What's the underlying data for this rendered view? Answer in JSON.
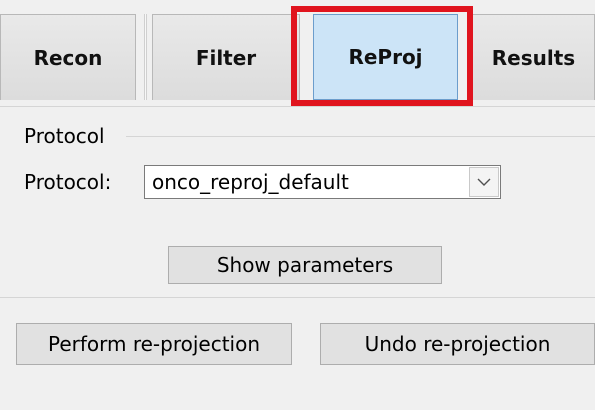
{
  "tabs": [
    {
      "label": "Recon"
    },
    {
      "label": "Filter"
    },
    {
      "label": "ReProj",
      "selected": true
    },
    {
      "label": "Results"
    }
  ],
  "highlight_color": "#e0141e",
  "protocol_group": {
    "title": "Protocol",
    "field_label": "Protocol:",
    "selected_value": "onco_reproj_default",
    "show_parameters_label": "Show parameters"
  },
  "actions": {
    "perform_label": "Perform re-projection",
    "undo_label": "Undo re-projection"
  }
}
